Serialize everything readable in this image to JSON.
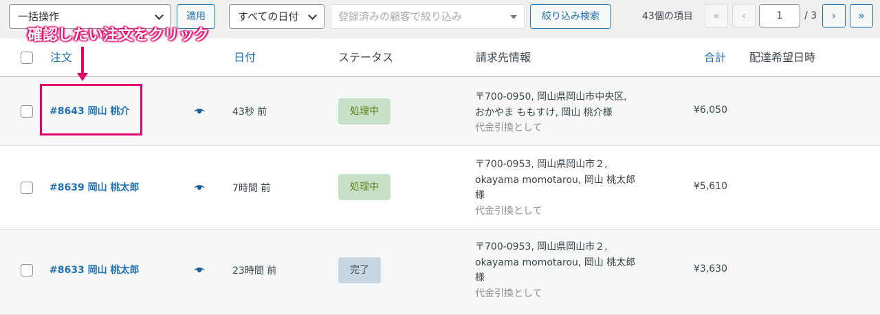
{
  "toolbar": {
    "bulk_action": "一括操作",
    "apply": "適用",
    "date_filter": "すべての日付",
    "customer_filter_placeholder": "登録済みの顧客で絞り込み",
    "filter_button": "絞り込み検索",
    "item_count": "43個の項目",
    "first_page": "«",
    "prev_page": "‹",
    "current_page": "1",
    "total_pages": "/ 3",
    "next_page": "›",
    "last_page": "»"
  },
  "table": {
    "columns": {
      "order": "注文",
      "date": "日付",
      "status": "ステータス",
      "billing": "請求先情報",
      "total": "合計",
      "delivery": "配達希望日時"
    },
    "rows": [
      {
        "order": "#8643 岡山 桃介",
        "date": "43秒 前",
        "status": "処理中",
        "billing_lines": [
          "〒700-0950, 岡山県岡山市中央区,",
          "おかやま ももすけ, 岡山 桃介様"
        ],
        "payment": "代金引換として",
        "total": "¥6,050"
      },
      {
        "order": "#8639 岡山 桃太郎",
        "date": "7時間 前",
        "status": "処理中",
        "billing_lines": [
          "〒700-0953, 岡山県岡山市２,",
          "okayama momotarou, 岡山 桃太郎",
          "様"
        ],
        "payment": "代金引換として",
        "total": "¥5,610"
      },
      {
        "order": "#8633 岡山 桃太郎",
        "date": "23時間 前",
        "status": "完了",
        "billing_lines": [
          "〒700-0953, 岡山県岡山市２,",
          "okayama momotarou, 岡山 桃太郎",
          "様"
        ],
        "payment": "代金引換として",
        "total": "¥3,630"
      }
    ]
  },
  "annotation": {
    "text": "確認したい注文をクリック",
    "color": "#e3006b"
  },
  "colors": {
    "link": "#2271b1",
    "processing_bg": "#c6e1c6",
    "processing_text": "#5b841b",
    "completed_bg": "#c8d7e1",
    "completed_text": "#2e4453"
  }
}
